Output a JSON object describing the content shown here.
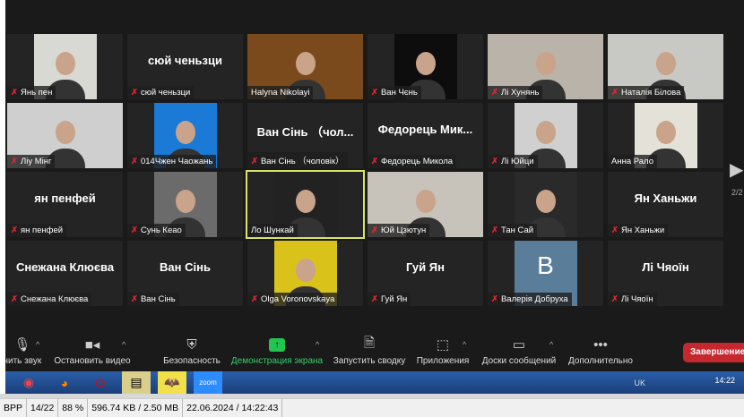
{
  "participants": [
    {
      "name": "Янь пен",
      "big": "",
      "video": "#d9d9d4",
      "muted": true
    },
    {
      "name": "сюй ченьзци",
      "big": "сюй ченьзци",
      "video": "",
      "muted": true
    },
    {
      "name": "Halyna Nikolayi",
      "big": "",
      "video": "#7a4a1c",
      "muted": false,
      "full": true
    },
    {
      "name": "Ван Чєнь",
      "big": "",
      "video": "#0d0d0d",
      "muted": true
    },
    {
      "name": "Лі Хунянь",
      "big": "",
      "video": "#b9b3aa",
      "muted": true,
      "full": true
    },
    {
      "name": "Наталія Білова",
      "big": "",
      "video": "#c8c8c4",
      "muted": true,
      "full": true
    },
    {
      "name": "Ліу Мінг",
      "big": "",
      "video": "#cfcfcf",
      "muted": true,
      "full": true
    },
    {
      "name": "014Чжен Чаожань",
      "big": "",
      "video": "#1a7ad6",
      "muted": true
    },
    {
      "name": "Ван Сінь （чоловік）",
      "big": "Ван Сінь （чол...",
      "video": "",
      "muted": true
    },
    {
      "name": "Федорець Микола",
      "big": "Федорець Мик...",
      "video": "",
      "muted": true
    },
    {
      "name": "Лі Юйци",
      "big": "",
      "video": "#d0d0d0",
      "muted": true
    },
    {
      "name": "Анна Рало",
      "big": "",
      "video": "#e4e2d8",
      "muted": false
    },
    {
      "name": "ян пенфей",
      "big": "ян пенфей",
      "video": "",
      "muted": true
    },
    {
      "name": "Сунь Кеао",
      "big": "",
      "video": "#6b6b6b",
      "muted": true
    },
    {
      "name": "Ло Шункай",
      "big": "",
      "video": "#222",
      "muted": false,
      "active": true
    },
    {
      "name": "Юй Цзютун",
      "big": "",
      "video": "#c7c3bb",
      "muted": true,
      "full": true
    },
    {
      "name": "Тан Сай",
      "big": "",
      "video": "#2a2a2a",
      "muted": true
    },
    {
      "name": "Ян Ханьжи",
      "big": "Ян Ханьжи",
      "video": "",
      "muted": true
    },
    {
      "name": "Снежана Клюєва",
      "big": "Снежана Клюєва",
      "video": "",
      "muted": true
    },
    {
      "name": "Ван Сінь",
      "big": "Ван Сінь",
      "video": "",
      "muted": true
    },
    {
      "name": "Olga Voronovskaya",
      "big": "",
      "video": "#d9c21a",
      "muted": true
    },
    {
      "name": "Гуй Ян",
      "big": "Гуй Ян",
      "video": "",
      "muted": true
    },
    {
      "name": "Валерія Добруха",
      "big": "B",
      "video": "#5a7d9a",
      "muted": true
    },
    {
      "name": "Лі Чяоїн",
      "big": "Лі Чяоїн",
      "video": "",
      "muted": true
    }
  ],
  "page_indicator": "2/2",
  "toolbar": {
    "audio": "чить звук",
    "video": "Остановить видео",
    "security": "Безопасность",
    "share": "Демонстрация экрана",
    "summary": "Запустить сводку",
    "apps": "Приложения",
    "whiteboards": "Доски сообщений",
    "more": "Дополнительно",
    "end": "Завершение"
  },
  "taskbar": {
    "lang": "UK",
    "time": "14:22",
    "zoom_label": "zoom"
  },
  "status": {
    "format": "BPP",
    "index": "14/22",
    "zoom": "88 %",
    "size": "596.74 KB / 2.50 MB",
    "datetime": "22.06.2024 / 14:22:43"
  },
  "colors": {
    "share": "#23c552",
    "end": "#c5282f",
    "mute": "#e0262f"
  }
}
